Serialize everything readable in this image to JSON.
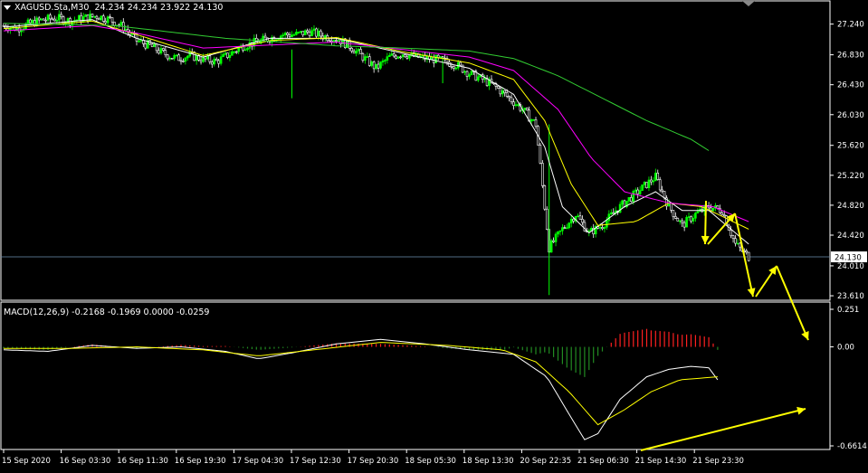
{
  "main_header": {
    "symbol": "XAGUSD.Sta,M30",
    "ohlc": "24.234 24.234 23.922 24.130"
  },
  "macd_header": {
    "label": "MACD(12,26,9) -0.2168 -0.1969 0.0000 -0.0259"
  },
  "colors": {
    "bull": "#00ff00",
    "bear": "#ffffff",
    "ma_fast": "#ffffff",
    "ma_mid": "#ffff00",
    "ma_slow": "#ff00ff",
    "ma_long": "#32cd32",
    "annotation": "#ffff00",
    "hist_neg": "#228b22",
    "hist_pos": "#ff2020",
    "grid_frame": "#ffffff",
    "price_line": "#6e8fb0"
  },
  "chart_data": [
    {
      "type": "candlestick",
      "title": "XAGUSD.Sta,M30",
      "y_ticks": [
        "27.240",
        "26.830",
        "26.430",
        "26.030",
        "25.620",
        "25.220",
        "24.820",
        "24.420",
        "24.010",
        "23.610"
      ],
      "ylim": [
        23.55,
        27.55
      ],
      "current_price_label": "24.130",
      "current_price": 24.13,
      "x_ticks": [
        "15 Sep 2020",
        "16 Sep 03:30",
        "16 Sep 11:30",
        "16 Sep 19:30",
        "17 Sep 04:30",
        "17 Sep 12:30",
        "17 Sep 20:30",
        "18 Sep 05:30",
        "18 Sep 13:30",
        "20 Sep 22:35",
        "21 Sep 06:30",
        "21 Sep 14:30",
        "21 Sep 23:30"
      ],
      "price_path": [
        [
          0,
          27.22
        ],
        [
          6,
          27.18
        ],
        [
          12,
          27.25
        ],
        [
          18,
          27.3
        ],
        [
          24,
          27.32
        ],
        [
          30,
          27.28
        ],
        [
          36,
          27.32
        ],
        [
          42,
          27.35
        ],
        [
          48,
          27.3
        ],
        [
          54,
          27.2
        ],
        [
          60,
          27.02
        ],
        [
          66,
          26.95
        ],
        [
          72,
          26.85
        ],
        [
          78,
          26.78
        ],
        [
          84,
          26.82
        ],
        [
          90,
          26.77
        ],
        [
          96,
          26.74
        ],
        [
          102,
          26.84
        ],
        [
          108,
          26.95
        ],
        [
          114,
          27.0
        ],
        [
          120,
          27.05
        ],
        [
          126,
          27.1
        ],
        [
          132,
          27.1
        ],
        [
          138,
          27.14
        ],
        [
          144,
          27.08
        ],
        [
          150,
          27.05
        ],
        [
          156,
          26.95
        ],
        [
          162,
          26.8
        ],
        [
          168,
          26.65
        ],
        [
          174,
          26.8
        ],
        [
          180,
          26.85
        ],
        [
          186,
          26.8
        ],
        [
          192,
          26.78
        ],
        [
          198,
          26.75
        ],
        [
          204,
          26.7
        ],
        [
          210,
          26.58
        ],
        [
          216,
          26.5
        ],
        [
          222,
          26.4
        ],
        [
          228,
          26.25
        ],
        [
          234,
          26.1
        ],
        [
          240,
          25.9
        ],
        [
          246,
          24.25
        ],
        [
          252,
          24.5
        ],
        [
          258,
          24.7
        ],
        [
          264,
          24.45
        ],
        [
          270,
          24.55
        ],
        [
          276,
          24.75
        ],
        [
          282,
          24.9
        ],
        [
          288,
          25.05
        ],
        [
          294,
          25.2
        ],
        [
          300,
          24.8
        ],
        [
          306,
          24.55
        ],
        [
          312,
          24.7
        ],
        [
          318,
          24.8
        ],
        [
          324,
          24.75
        ],
        [
          330,
          24.3
        ],
        [
          336,
          24.13
        ]
      ],
      "moving_averages": [
        {
          "role": "ma_fast",
          "points": [
            [
              0,
              27.2
            ],
            [
              40,
              27.3
            ],
            [
              60,
              27.05
            ],
            [
              90,
              26.8
            ],
            [
              120,
              27.05
            ],
            [
              150,
              27.05
            ],
            [
              180,
              26.85
            ],
            [
              210,
              26.65
            ],
            [
              230,
              26.3
            ],
            [
              244,
              25.6
            ],
            [
              252,
              24.8
            ],
            [
              264,
              24.45
            ],
            [
              280,
              24.8
            ],
            [
              294,
              25.0
            ],
            [
              306,
              24.75
            ],
            [
              318,
              24.75
            ],
            [
              336,
              24.3
            ]
          ]
        },
        {
          "role": "ma_mid",
          "points": [
            [
              0,
              27.18
            ],
            [
              40,
              27.28
            ],
            [
              60,
              27.1
            ],
            [
              90,
              26.82
            ],
            [
              120,
              27.02
            ],
            [
              150,
              27.06
            ],
            [
              180,
              26.87
            ],
            [
              210,
              26.72
            ],
            [
              230,
              26.5
            ],
            [
              244,
              25.95
            ],
            [
              256,
              25.1
            ],
            [
              268,
              24.55
            ],
            [
              285,
              24.6
            ],
            [
              300,
              24.85
            ],
            [
              315,
              24.8
            ],
            [
              336,
              24.5
            ]
          ]
        },
        {
          "role": "ma_slow",
          "points": [
            [
              0,
              27.15
            ],
            [
              40,
              27.22
            ],
            [
              60,
              27.12
            ],
            [
              90,
              26.92
            ],
            [
              120,
              26.96
            ],
            [
              150,
              27.0
            ],
            [
              180,
              26.9
            ],
            [
              210,
              26.8
            ],
            [
              230,
              26.62
            ],
            [
              250,
              26.1
            ],
            [
              265,
              25.45
            ],
            [
              280,
              25.0
            ],
            [
              300,
              24.85
            ],
            [
              320,
              24.8
            ],
            [
              336,
              24.6
            ]
          ]
        },
        {
          "role": "ma_long",
          "points": [
            [
              0,
              27.25
            ],
            [
              50,
              27.22
            ],
            [
              100,
              27.05
            ],
            [
              150,
              26.95
            ],
            [
              180,
              26.92
            ],
            [
              210,
              26.88
            ],
            [
              230,
              26.78
            ],
            [
              250,
              26.55
            ],
            [
              270,
              26.25
            ],
            [
              290,
              25.95
            ],
            [
              310,
              25.7
            ],
            [
              318,
              25.55
            ]
          ]
        }
      ]
    },
    {
      "type": "macd",
      "title": "MACD(12,26,9)",
      "values": {
        "macd": -0.2168,
        "signal": -0.1969,
        "third": 0.0,
        "hist": -0.0259
      },
      "y_ticks": [
        "0.251",
        "0.00",
        "-0.6614"
      ],
      "ylim": [
        -0.6614,
        0.251
      ]
    }
  ]
}
